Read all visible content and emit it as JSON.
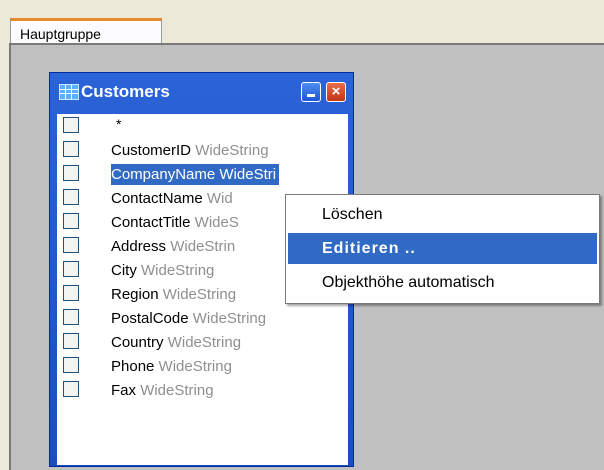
{
  "tabs": {
    "active": "Hauptgruppe"
  },
  "table": {
    "title": "Customers",
    "star": "*",
    "fields": [
      {
        "name": "CustomerID",
        "type": "WideString"
      },
      {
        "name": "CompanyName",
        "type": "WideString",
        "type_visible": "WideStri"
      },
      {
        "name": "ContactName",
        "type": "WideString",
        "type_visible": "Wid"
      },
      {
        "name": "ContactTitle",
        "type": "WideString",
        "type_visible": "WideS"
      },
      {
        "name": "Address",
        "type": "WideString",
        "type_visible": "WideStrin"
      },
      {
        "name": "City",
        "type": "WideString"
      },
      {
        "name": "Region",
        "type": "WideString"
      },
      {
        "name": "PostalCode",
        "type": "WideString"
      },
      {
        "name": "Country",
        "type": "WideString"
      },
      {
        "name": "Phone",
        "type": "WideString"
      },
      {
        "name": "Fax",
        "type": "WideString"
      }
    ],
    "selected_field": "CompanyName"
  },
  "context_menu": {
    "items": [
      "Löschen",
      "Editieren ..",
      "Objekthöhe automatisch"
    ],
    "highlighted": "Editieren .."
  },
  "colors": {
    "selection": "#316ac5",
    "title_bar": "#2b63d8",
    "canvas": "#c0c0c0",
    "type_text": "#8f8f8f",
    "tab_accent": "#e68b2c"
  }
}
